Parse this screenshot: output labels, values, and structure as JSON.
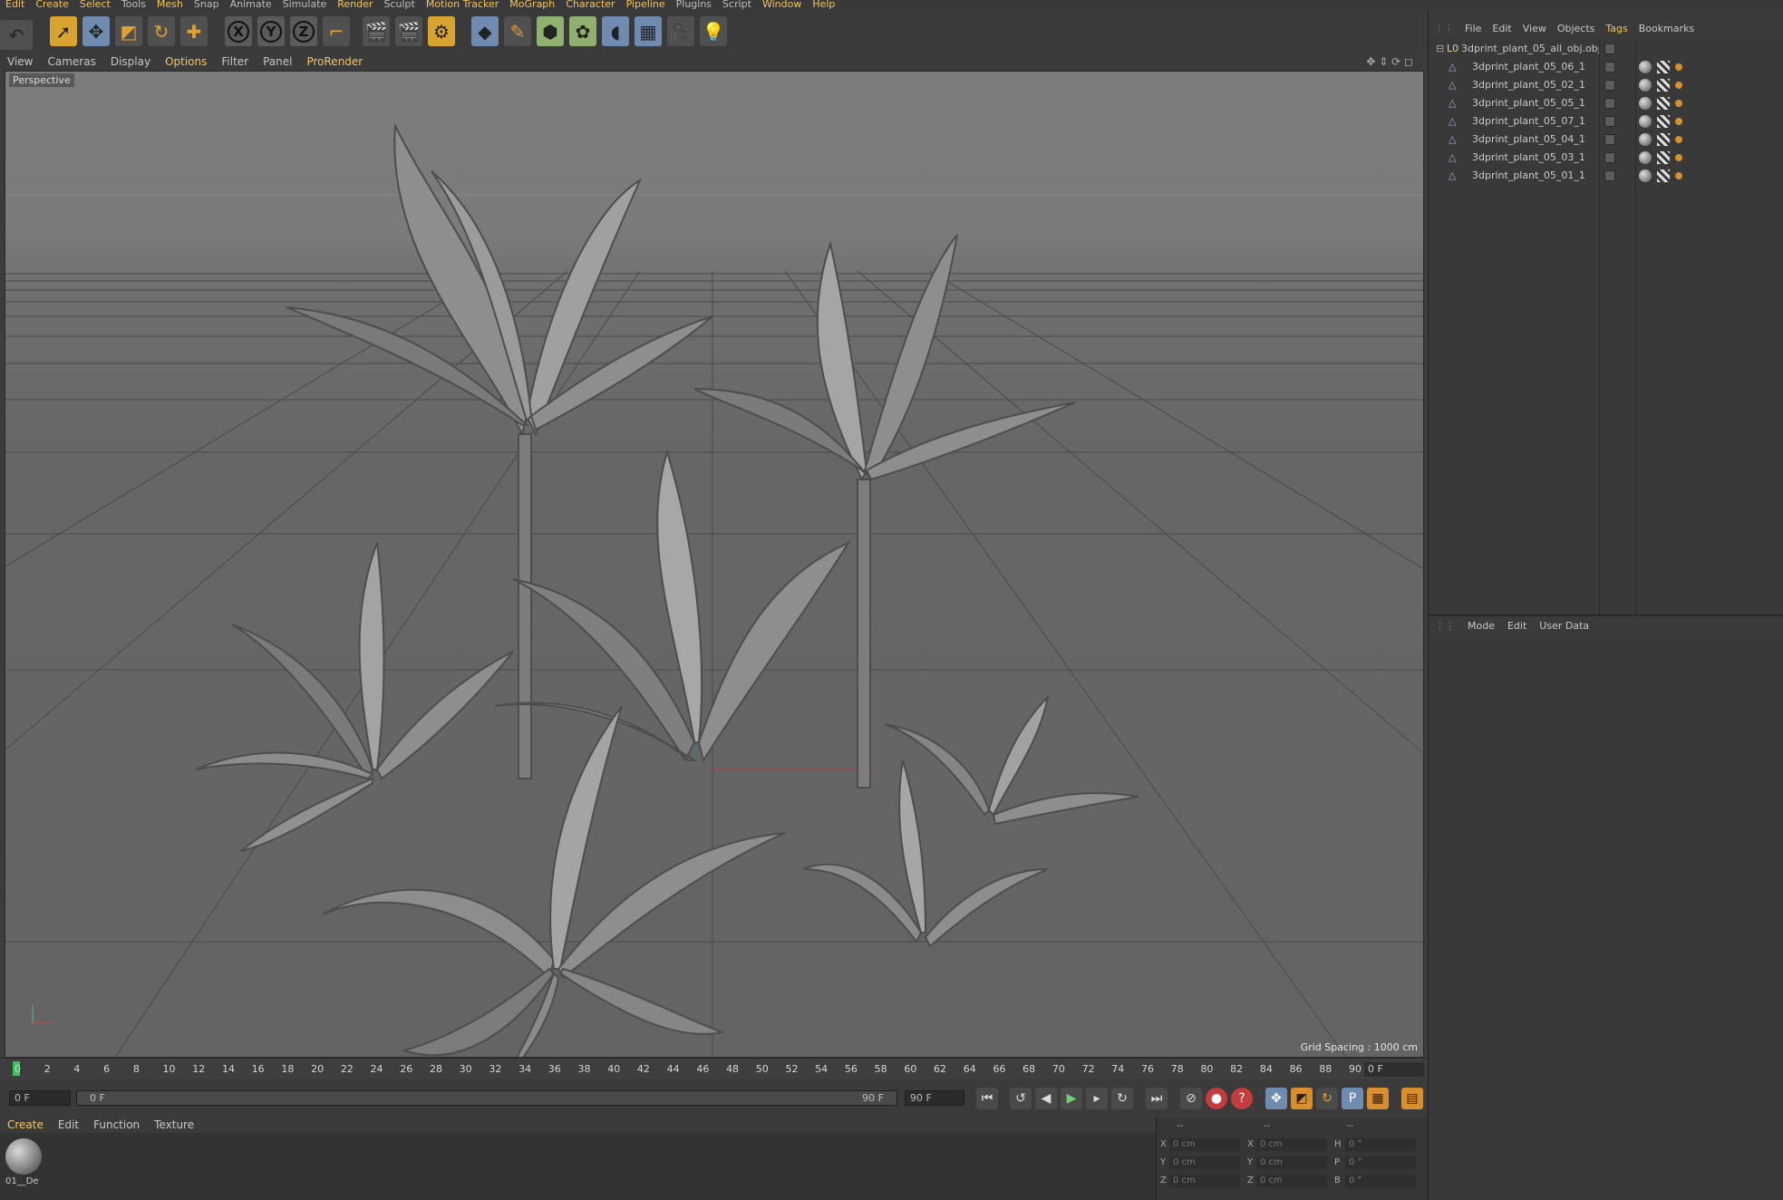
{
  "menubar": {
    "items": [
      {
        "label": "Edit",
        "hl": true
      },
      {
        "label": "Create",
        "hl": true
      },
      {
        "label": "Select",
        "hl": true
      },
      {
        "label": "Tools",
        "hl": false
      },
      {
        "label": "Mesh",
        "hl": true
      },
      {
        "label": "Snap",
        "hl": false
      },
      {
        "label": "Animate",
        "hl": false
      },
      {
        "label": "Simulate",
        "hl": false
      },
      {
        "label": "Render",
        "hl": true
      },
      {
        "label": "Sculpt",
        "hl": false
      },
      {
        "label": "Motion Tracker",
        "hl": true
      },
      {
        "label": "MoGraph",
        "hl": true
      },
      {
        "label": "Character",
        "hl": true
      },
      {
        "label": "Pipeline",
        "hl": true
      },
      {
        "label": "Plugins",
        "hl": false
      },
      {
        "label": "Script",
        "hl": false
      },
      {
        "label": "Window",
        "hl": true
      },
      {
        "label": "Help",
        "hl": true
      }
    ]
  },
  "toolbar": {
    "axis_x": "X",
    "axis_y": "Y",
    "axis_z": "Z"
  },
  "viewport_menu": {
    "items": [
      "View",
      "Cameras",
      "Display",
      "Options",
      "Filter",
      "Panel",
      "ProRender"
    ],
    "active": "Options"
  },
  "viewport": {
    "label": "Perspective",
    "grid_spacing": "Grid Spacing : 1000 cm"
  },
  "timeline": {
    "ticks": [
      "0",
      "2",
      "4",
      "6",
      "8",
      "10",
      "12",
      "14",
      "16",
      "18",
      "20",
      "22",
      "24",
      "26",
      "28",
      "30",
      "32",
      "34",
      "36",
      "38",
      "40",
      "42",
      "44",
      "46",
      "48",
      "50",
      "52",
      "54",
      "56",
      "58",
      "60",
      "62",
      "64",
      "66",
      "68",
      "70",
      "72",
      "74",
      "76",
      "78",
      "80",
      "82",
      "84",
      "86",
      "88",
      "90"
    ],
    "current_frame": "0 F"
  },
  "transport": {
    "start_field": "0 F",
    "range_start": "0 F",
    "range_end": "90 F",
    "end_field": "90 F"
  },
  "material_manager": {
    "menu": [
      "Create",
      "Edit",
      "Function",
      "Texture"
    ],
    "active": "Create",
    "material_name": "01__De"
  },
  "coordinates": {
    "header": [
      "--",
      "--",
      "--"
    ],
    "rows": [
      {
        "a": "X",
        "av": "0 cm",
        "b": "X",
        "bv": "0 cm",
        "c": "H",
        "cv": "0 °"
      },
      {
        "a": "Y",
        "av": "0 cm",
        "b": "Y",
        "bv": "0 cm",
        "c": "P",
        "cv": "0 °"
      },
      {
        "a": "Z",
        "av": "0 cm",
        "b": "Z",
        "bv": "0 cm",
        "c": "B",
        "cv": "0 °"
      }
    ]
  },
  "object_manager": {
    "menu": [
      "File",
      "Edit",
      "View",
      "Objects",
      "Tags",
      "Bookmarks"
    ],
    "active": "Tags",
    "root": "3dprint_plant_05_all_obj.obj",
    "children": [
      "3dprint_plant_05_06_1",
      "3dprint_plant_05_02_1",
      "3dprint_plant_05_05_1",
      "3dprint_plant_05_07_1",
      "3dprint_plant_05_04_1",
      "3dprint_plant_05_03_1",
      "3dprint_plant_05_01_1"
    ]
  },
  "attribute_manager": {
    "menu": [
      "Mode",
      "Edit",
      "User Data"
    ]
  },
  "colors": {
    "accent": "#f4c55a",
    "background": "#3c3c3c",
    "viewport": "#666666"
  }
}
